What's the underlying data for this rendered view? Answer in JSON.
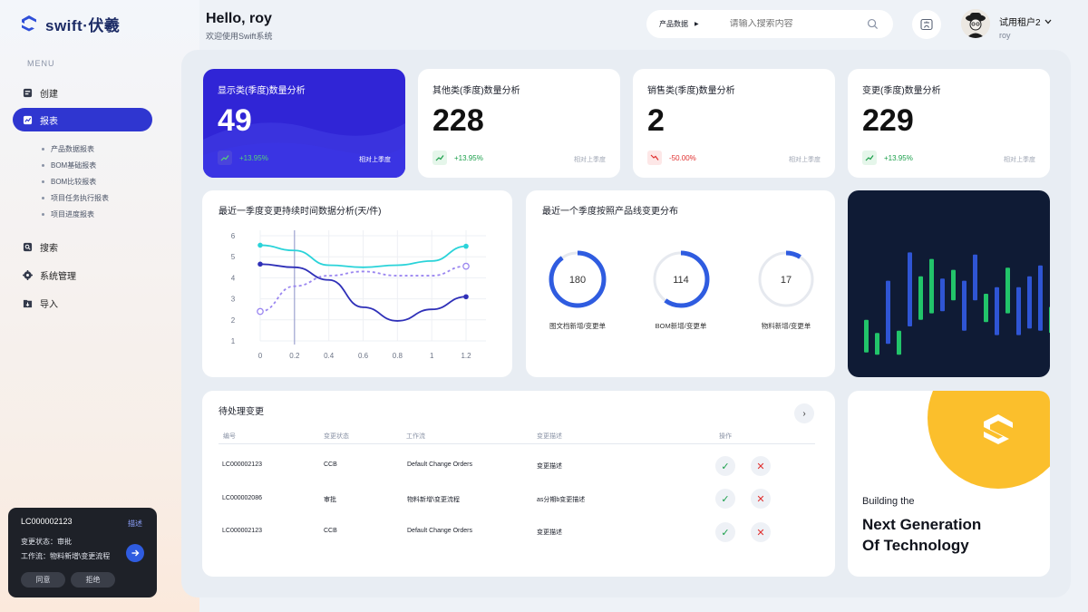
{
  "app": {
    "brand": "swift·伏羲"
  },
  "menu": {
    "title": "MENU",
    "items": [
      {
        "label": "创建",
        "icon": "create-icon"
      },
      {
        "label": "报表",
        "icon": "chart-icon"
      },
      {
        "label": "搜索",
        "icon": "search-icon"
      },
      {
        "label": "系统管理",
        "icon": "gear-icon"
      },
      {
        "label": "导入",
        "icon": "import-icon"
      }
    ],
    "subitems": [
      "产品数据报表",
      "BOM基础报表",
      "BOM比较报表",
      "项目任务执行报表",
      "项目进度报表"
    ]
  },
  "mini_card": {
    "code": "LC000002123",
    "desc_link": "描述",
    "status_line": "变更状态：审批",
    "workflow_line": "工作流：物料新增\\变更流程",
    "approve": "同意",
    "reject": "拒绝"
  },
  "header": {
    "hello": "Hello, roy",
    "welcome": "欢迎使用Swift系统",
    "search_category": "产品数据",
    "search_placeholder": "请输入搜索内容",
    "tenant": "试用租户2",
    "username": "roy"
  },
  "stats": [
    {
      "title": "显示类(季度)数量分析",
      "value": "49",
      "pct": "+13.95%",
      "cmp": "相对上季度",
      "dir": "up"
    },
    {
      "title": "其他类(季度)数量分析",
      "value": "228",
      "pct": "+13.95%",
      "cmp": "相对上季度",
      "dir": "up"
    },
    {
      "title": "销售类(季度)数量分析",
      "value": "2",
      "pct": "-50.00%",
      "cmp": "相对上季度",
      "dir": "down"
    },
    {
      "title": "变更(季度)数量分析",
      "value": "229",
      "pct": "+13.95%",
      "cmp": "相对上季度",
      "dir": "up"
    }
  ],
  "line_chart_title": "最近一季度变更持续时间数据分析(天/件)",
  "donut_title": "最近一个季度按照产品线变更分布",
  "table": {
    "title": "待处理变更",
    "columns": [
      "编号",
      "变更状态",
      "工作流",
      "变更描述",
      "操作"
    ],
    "rows": [
      [
        "LC000002123",
        "CCB",
        "Default Change Orders",
        "变更描述"
      ],
      [
        "LC000002086",
        "审批",
        "物料新增\\变更流程",
        "as分期b变更描述"
      ],
      [
        "LC000002123",
        "CCB",
        "Default Change Orders",
        "变更描述"
      ]
    ]
  },
  "promo": {
    "line1": "Building the",
    "line2": "Next Generation",
    "line3": "Of Technology"
  },
  "colors": {
    "accent": "#3025d6",
    "up": "#1a9f4a",
    "down": "#e0302f",
    "yellow": "#fbbf2c",
    "dark": "#0f1b35"
  },
  "chart_data": [
    {
      "type": "line",
      "x": [
        0,
        0.2,
        0.4,
        0.6,
        0.8,
        1,
        1.2
      ],
      "xlim": [
        0,
        1.2
      ],
      "ylim": [
        1,
        6
      ],
      "yticks": [
        1,
        2,
        3,
        4,
        5,
        6
      ],
      "series": [
        {
          "color": "#2ad3d9",
          "points": [
            [
              0,
              5.55
            ],
            [
              0.2,
              5.3
            ],
            [
              0.4,
              4.6
            ],
            [
              0.6,
              4.5
            ],
            [
              0.8,
              4.6
            ],
            [
              1,
              4.8
            ],
            [
              1.2,
              5.5
            ]
          ]
        },
        {
          "color": "#2f30b8",
          "points": [
            [
              0,
              4.65
            ],
            [
              0.2,
              4.5
            ],
            [
              0.4,
              3.9
            ],
            [
              0.6,
              2.6
            ],
            [
              0.8,
              1.95
            ],
            [
              1,
              2.5
            ],
            [
              1.2,
              3.1
            ]
          ]
        },
        {
          "color": "#9a86f0",
          "dashed": true,
          "points": [
            [
              0,
              2.4
            ],
            [
              0.2,
              3.6
            ],
            [
              0.4,
              4.1
            ],
            [
              0.6,
              4.3
            ],
            [
              0.8,
              4.1
            ],
            [
              1,
              4.1
            ],
            [
              1.2,
              4.55
            ]
          ]
        }
      ],
      "cursor_x": 0.2
    },
    {
      "type": "pie",
      "items": [
        {
          "label": "图文档新增/变更单",
          "value": 180,
          "fraction": 0.9
        },
        {
          "label": "BOM新增/变更单",
          "value": 114,
          "fraction": 0.6
        },
        {
          "label": "物料新增/变更单",
          "value": 17,
          "fraction": 0.09
        }
      ]
    },
    {
      "type": "bar",
      "title": "",
      "bars": [
        {
          "low": 0.06,
          "high": 0.36,
          "color": "#22c46a"
        },
        {
          "low": 0.04,
          "high": 0.24,
          "color": "#22c46a"
        },
        {
          "low": 0.14,
          "high": 0.72,
          "color": "#2f55d4"
        },
        {
          "low": 0.04,
          "high": 0.26,
          "color": "#22c46a"
        },
        {
          "low": 0.3,
          "high": 0.98,
          "color": "#2f55d4"
        },
        {
          "low": 0.36,
          "high": 0.76,
          "color": "#22c46a"
        },
        {
          "low": 0.42,
          "high": 0.92,
          "color": "#22c46a"
        },
        {
          "low": 0.44,
          "high": 0.74,
          "color": "#2f55d4"
        },
        {
          "low": 0.54,
          "high": 0.82,
          "color": "#22c46a"
        },
        {
          "low": 0.26,
          "high": 0.72,
          "color": "#2f55d4"
        },
        {
          "low": 0.54,
          "high": 0.96,
          "color": "#2f55d4"
        },
        {
          "low": 0.34,
          "high": 0.6,
          "color": "#22c46a"
        },
        {
          "low": 0.22,
          "high": 0.66,
          "color": "#2f55d4"
        },
        {
          "low": 0.42,
          "high": 0.84,
          "color": "#22c46a"
        },
        {
          "low": 0.22,
          "high": 0.66,
          "color": "#2f55d4"
        },
        {
          "low": 0.28,
          "high": 0.76,
          "color": "#2f55d4"
        },
        {
          "low": 0.26,
          "high": 0.86,
          "color": "#2f55d4"
        },
        {
          "low": 0.24,
          "high": 0.48,
          "color": "#22c46a"
        },
        {
          "low": 0.12,
          "high": 0.24,
          "color": "#22c46a"
        }
      ]
    }
  ]
}
